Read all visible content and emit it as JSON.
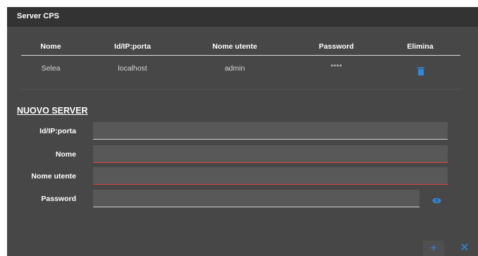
{
  "dialog": {
    "title": "Server CPS"
  },
  "table": {
    "headers": [
      "Nome",
      "Id/IP:porta",
      "Nome utente",
      "Password",
      "Elimina"
    ],
    "rows": [
      {
        "nome": "Selea",
        "indirizzo": "localhost",
        "utente": "admin",
        "password": "****",
        "elimina_icon": "trash-icon"
      }
    ]
  },
  "nuovo_server": {
    "heading": "NUOVO SERVER",
    "fields": [
      {
        "label": "Id/IP:porta",
        "value": ""
      },
      {
        "label": "Nome",
        "value": ""
      },
      {
        "label": "Nome utente",
        "value": ""
      },
      {
        "label": "Password",
        "value": ""
      }
    ],
    "password_toggle_icon": "eye-icon"
  },
  "actions": {
    "add_label": "+",
    "close_label": "✕"
  },
  "colors": {
    "accent": "#2f88e0",
    "error_underline": "#d9443a",
    "panel": "#474747",
    "titlebar": "#333333"
  }
}
